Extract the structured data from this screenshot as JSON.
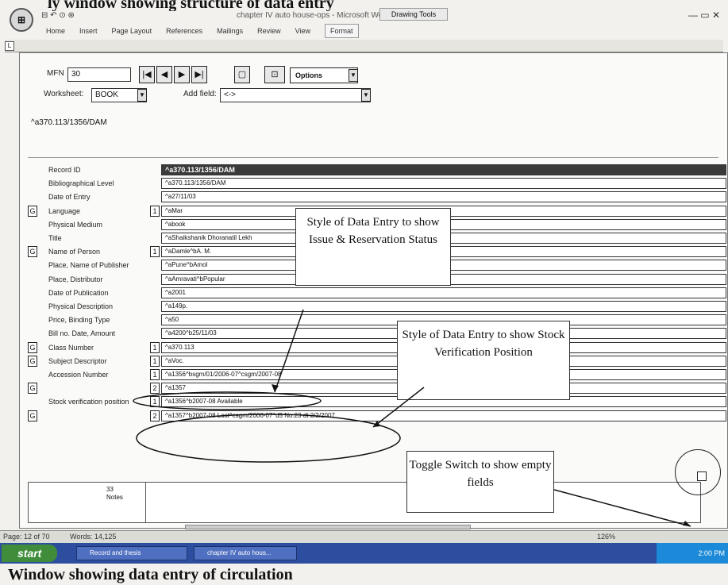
{
  "caption_top": "ly window showing structure of data entry",
  "caption_bottom": "Window showing data entry of circulation",
  "title_bar": {
    "office_button": "⊞",
    "quick_access": "⊟ ↶ ⊙ ⊛",
    "document_title": "chapter IV auto house-ops - Microsoft Word",
    "context_tab": "Drawing Tools",
    "window_controls": "— ▭ ✕"
  },
  "ribbon_tabs": [
    "Home",
    "Insert",
    "Page Layout",
    "References",
    "Mailings",
    "Review",
    "View",
    "Format"
  ],
  "ruler_box": "L",
  "toolbar": {
    "mfn_label": "MFN",
    "mfn_value": "30",
    "nav_first": "|◀",
    "nav_prev": "◀",
    "nav_next": "▶",
    "nav_last": "▶|",
    "options_label": "Options",
    "worksheet_label": "Worksheet:",
    "worksheet_value": "BOOK",
    "addfield_label": "Add field:",
    "addfield_value": "<->"
  },
  "path_text": "^a370.113/1356/DAM",
  "rows": [
    {
      "label": "Record ID",
      "g": "",
      "occ": "",
      "value": "^a370.113/1356/DAM",
      "header": true
    },
    {
      "label": "Bibliographical Level",
      "g": "",
      "occ": "",
      "value": "^a370.113/1356/DAM"
    },
    {
      "label": "Date of Entry",
      "g": "",
      "occ": "",
      "value": "^a27/11/03"
    },
    {
      "label": "Language",
      "g": "G",
      "occ": "1",
      "value": "^aMar"
    },
    {
      "label": "Physical Medium",
      "g": "",
      "occ": "",
      "value": "^abook"
    },
    {
      "label": "Title",
      "g": "",
      "occ": "",
      "value": "^aShaikshanik Dhoranatil Lekh"
    },
    {
      "label": "Name of Person",
      "g": "G",
      "occ": "1",
      "value": "^aDamle^bA. M."
    },
    {
      "label": "Place, Name of Publisher",
      "g": "",
      "occ": "",
      "value": "^aPune^bAmol"
    },
    {
      "label": "Place, Distributor",
      "g": "",
      "occ": "",
      "value": "^aAmravati^bPopular"
    },
    {
      "label": "Date of Publication",
      "g": "",
      "occ": "",
      "value": "^a2001"
    },
    {
      "label": "Physical Description",
      "g": "",
      "occ": "",
      "value": "^a149p."
    },
    {
      "label": "Price, Binding Type",
      "g": "",
      "occ": "",
      "value": "^a50"
    },
    {
      "label": "Bill no. Date, Amount",
      "g": "",
      "occ": "",
      "value": "^a4200^b25/11/03"
    },
    {
      "label": "Class Number",
      "g": "G",
      "occ": "1",
      "value": "^a370.113"
    },
    {
      "label": "Subject Descriptor",
      "g": "G",
      "occ": "1",
      "value": "^aVoc."
    },
    {
      "label": "Accession Number",
      "g": "",
      "occ": "1",
      "value": "^a1356^bsgm/01/2006-07^csgm/2007-08"
    },
    {
      "label": "",
      "g": "G",
      "occ": "2",
      "value": "^a1357"
    },
    {
      "label": "Stock verification position",
      "g": "",
      "occ": "1",
      "value": "^a1356^b2007-08 Available"
    },
    {
      "label": "",
      "g": "G",
      "occ": "2",
      "value": "^a1357^b2007-08 Lost^csgm/2006-07^d5 No.23 dt 2/2/2007"
    }
  ],
  "callouts": {
    "issue": "Style of Data Entry to show Issue & Reservation Status",
    "stock": "Style of Data Entry to show Stock Verification Position",
    "toggle": "Toggle Switch to show empty fields"
  },
  "notes": {
    "count": "33",
    "label": "Notes"
  },
  "status_bar": {
    "page": "Page: 12 of 70",
    "words": "Words: 14,125",
    "zoom": "126%"
  },
  "taskbar": {
    "start": "start",
    "items": [
      "Record and thesis",
      "chapter IV auto hous..."
    ],
    "tray_time": "2:00 PM"
  },
  "colors": {
    "taskbar": "#2d4e9e",
    "start": "#3f8d3a",
    "header_row": "#3a3a3a"
  }
}
